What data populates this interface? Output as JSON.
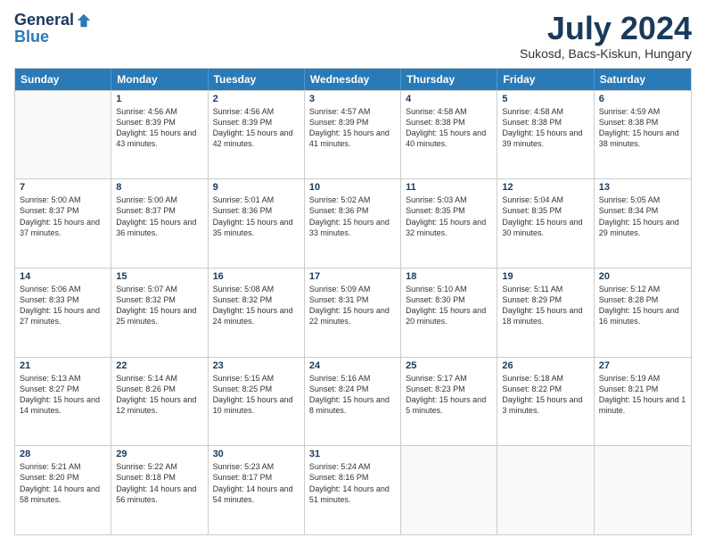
{
  "logo": {
    "general": "General",
    "blue": "Blue"
  },
  "header": {
    "month": "July 2024",
    "location": "Sukosd, Bacs-Kiskun, Hungary"
  },
  "weekdays": [
    "Sunday",
    "Monday",
    "Tuesday",
    "Wednesday",
    "Thursday",
    "Friday",
    "Saturday"
  ],
  "weeks": [
    [
      {
        "day": "",
        "sunrise": "",
        "sunset": "",
        "daylight": ""
      },
      {
        "day": "1",
        "sunrise": "Sunrise: 4:56 AM",
        "sunset": "Sunset: 8:39 PM",
        "daylight": "Daylight: 15 hours and 43 minutes."
      },
      {
        "day": "2",
        "sunrise": "Sunrise: 4:56 AM",
        "sunset": "Sunset: 8:39 PM",
        "daylight": "Daylight: 15 hours and 42 minutes."
      },
      {
        "day": "3",
        "sunrise": "Sunrise: 4:57 AM",
        "sunset": "Sunset: 8:39 PM",
        "daylight": "Daylight: 15 hours and 41 minutes."
      },
      {
        "day": "4",
        "sunrise": "Sunrise: 4:58 AM",
        "sunset": "Sunset: 8:38 PM",
        "daylight": "Daylight: 15 hours and 40 minutes."
      },
      {
        "day": "5",
        "sunrise": "Sunrise: 4:58 AM",
        "sunset": "Sunset: 8:38 PM",
        "daylight": "Daylight: 15 hours and 39 minutes."
      },
      {
        "day": "6",
        "sunrise": "Sunrise: 4:59 AM",
        "sunset": "Sunset: 8:38 PM",
        "daylight": "Daylight: 15 hours and 38 minutes."
      }
    ],
    [
      {
        "day": "7",
        "sunrise": "Sunrise: 5:00 AM",
        "sunset": "Sunset: 8:37 PM",
        "daylight": "Daylight: 15 hours and 37 minutes."
      },
      {
        "day": "8",
        "sunrise": "Sunrise: 5:00 AM",
        "sunset": "Sunset: 8:37 PM",
        "daylight": "Daylight: 15 hours and 36 minutes."
      },
      {
        "day": "9",
        "sunrise": "Sunrise: 5:01 AM",
        "sunset": "Sunset: 8:36 PM",
        "daylight": "Daylight: 15 hours and 35 minutes."
      },
      {
        "day": "10",
        "sunrise": "Sunrise: 5:02 AM",
        "sunset": "Sunset: 8:36 PM",
        "daylight": "Daylight: 15 hours and 33 minutes."
      },
      {
        "day": "11",
        "sunrise": "Sunrise: 5:03 AM",
        "sunset": "Sunset: 8:35 PM",
        "daylight": "Daylight: 15 hours and 32 minutes."
      },
      {
        "day": "12",
        "sunrise": "Sunrise: 5:04 AM",
        "sunset": "Sunset: 8:35 PM",
        "daylight": "Daylight: 15 hours and 30 minutes."
      },
      {
        "day": "13",
        "sunrise": "Sunrise: 5:05 AM",
        "sunset": "Sunset: 8:34 PM",
        "daylight": "Daylight: 15 hours and 29 minutes."
      }
    ],
    [
      {
        "day": "14",
        "sunrise": "Sunrise: 5:06 AM",
        "sunset": "Sunset: 8:33 PM",
        "daylight": "Daylight: 15 hours and 27 minutes."
      },
      {
        "day": "15",
        "sunrise": "Sunrise: 5:07 AM",
        "sunset": "Sunset: 8:32 PM",
        "daylight": "Daylight: 15 hours and 25 minutes."
      },
      {
        "day": "16",
        "sunrise": "Sunrise: 5:08 AM",
        "sunset": "Sunset: 8:32 PM",
        "daylight": "Daylight: 15 hours and 24 minutes."
      },
      {
        "day": "17",
        "sunrise": "Sunrise: 5:09 AM",
        "sunset": "Sunset: 8:31 PM",
        "daylight": "Daylight: 15 hours and 22 minutes."
      },
      {
        "day": "18",
        "sunrise": "Sunrise: 5:10 AM",
        "sunset": "Sunset: 8:30 PM",
        "daylight": "Daylight: 15 hours and 20 minutes."
      },
      {
        "day": "19",
        "sunrise": "Sunrise: 5:11 AM",
        "sunset": "Sunset: 8:29 PM",
        "daylight": "Daylight: 15 hours and 18 minutes."
      },
      {
        "day": "20",
        "sunrise": "Sunrise: 5:12 AM",
        "sunset": "Sunset: 8:28 PM",
        "daylight": "Daylight: 15 hours and 16 minutes."
      }
    ],
    [
      {
        "day": "21",
        "sunrise": "Sunrise: 5:13 AM",
        "sunset": "Sunset: 8:27 PM",
        "daylight": "Daylight: 15 hours and 14 minutes."
      },
      {
        "day": "22",
        "sunrise": "Sunrise: 5:14 AM",
        "sunset": "Sunset: 8:26 PM",
        "daylight": "Daylight: 15 hours and 12 minutes."
      },
      {
        "day": "23",
        "sunrise": "Sunrise: 5:15 AM",
        "sunset": "Sunset: 8:25 PM",
        "daylight": "Daylight: 15 hours and 10 minutes."
      },
      {
        "day": "24",
        "sunrise": "Sunrise: 5:16 AM",
        "sunset": "Sunset: 8:24 PM",
        "daylight": "Daylight: 15 hours and 8 minutes."
      },
      {
        "day": "25",
        "sunrise": "Sunrise: 5:17 AM",
        "sunset": "Sunset: 8:23 PM",
        "daylight": "Daylight: 15 hours and 5 minutes."
      },
      {
        "day": "26",
        "sunrise": "Sunrise: 5:18 AM",
        "sunset": "Sunset: 8:22 PM",
        "daylight": "Daylight: 15 hours and 3 minutes."
      },
      {
        "day": "27",
        "sunrise": "Sunrise: 5:19 AM",
        "sunset": "Sunset: 8:21 PM",
        "daylight": "Daylight: 15 hours and 1 minute."
      }
    ],
    [
      {
        "day": "28",
        "sunrise": "Sunrise: 5:21 AM",
        "sunset": "Sunset: 8:20 PM",
        "daylight": "Daylight: 14 hours and 58 minutes."
      },
      {
        "day": "29",
        "sunrise": "Sunrise: 5:22 AM",
        "sunset": "Sunset: 8:18 PM",
        "daylight": "Daylight: 14 hours and 56 minutes."
      },
      {
        "day": "30",
        "sunrise": "Sunrise: 5:23 AM",
        "sunset": "Sunset: 8:17 PM",
        "daylight": "Daylight: 14 hours and 54 minutes."
      },
      {
        "day": "31",
        "sunrise": "Sunrise: 5:24 AM",
        "sunset": "Sunset: 8:16 PM",
        "daylight": "Daylight: 14 hours and 51 minutes."
      },
      {
        "day": "",
        "sunrise": "",
        "sunset": "",
        "daylight": ""
      },
      {
        "day": "",
        "sunrise": "",
        "sunset": "",
        "daylight": ""
      },
      {
        "day": "",
        "sunrise": "",
        "sunset": "",
        "daylight": ""
      }
    ]
  ]
}
